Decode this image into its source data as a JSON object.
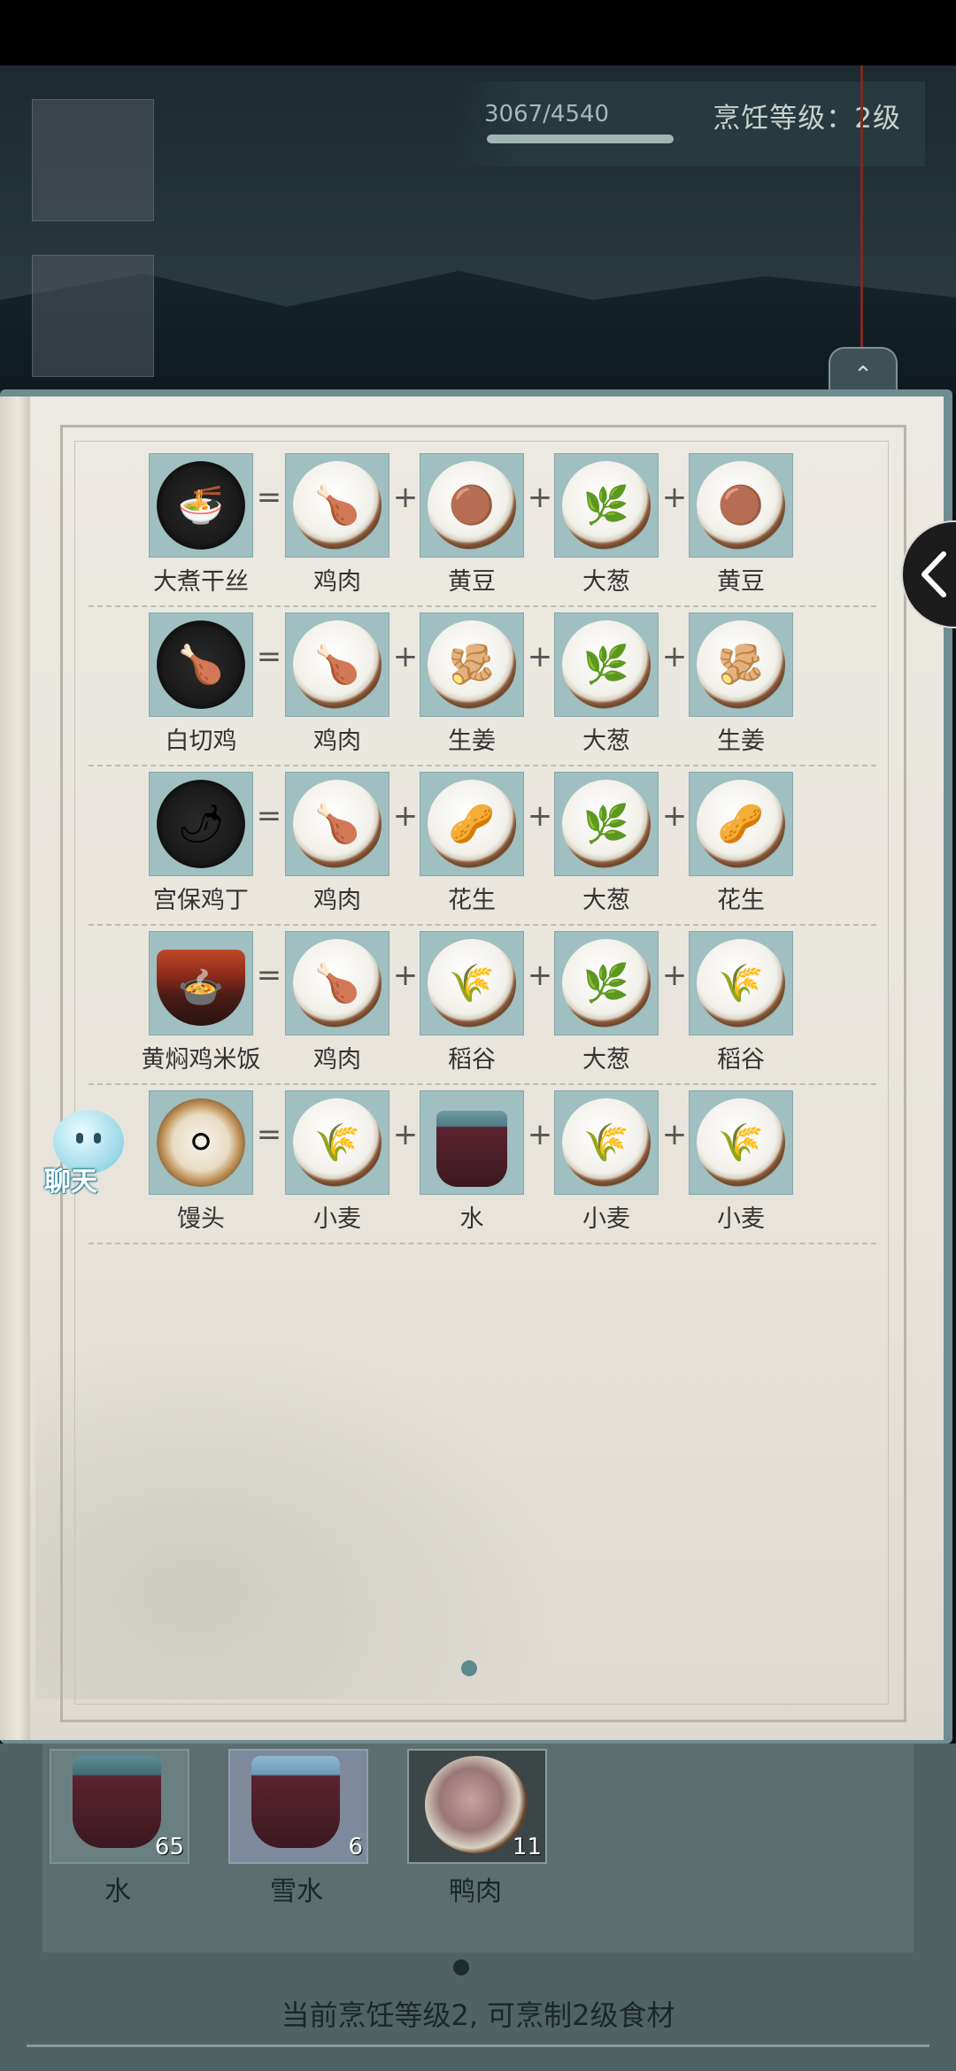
{
  "xp": {
    "text": "3067/4540",
    "current": 3067,
    "max": 4540
  },
  "cooking_level_text": "烹饪等级：2级",
  "recipes": [
    {
      "dish": "大煮干丝",
      "dish_icon": "shredded-tofu-dish-icon",
      "ops": [
        "=",
        "+",
        "+",
        "+"
      ],
      "ingredients": [
        {
          "name": "鸡肉",
          "icon": "chicken-meat-icon"
        },
        {
          "name": "黄豆",
          "icon": "soybean-icon"
        },
        {
          "name": "大葱",
          "icon": "scallion-icon"
        },
        {
          "name": "黄豆",
          "icon": "soybean-icon"
        }
      ]
    },
    {
      "dish": "白切鸡",
      "dish_icon": "white-cut-chicken-icon",
      "ops": [
        "=",
        "+",
        "+",
        "+"
      ],
      "ingredients": [
        {
          "name": "鸡肉",
          "icon": "chicken-meat-icon"
        },
        {
          "name": "生姜",
          "icon": "ginger-icon"
        },
        {
          "name": "大葱",
          "icon": "scallion-icon"
        },
        {
          "name": "生姜",
          "icon": "ginger-icon"
        }
      ]
    },
    {
      "dish": "宫保鸡丁",
      "dish_icon": "kung-pao-chicken-icon",
      "ops": [
        "=",
        "+",
        "+",
        "+"
      ],
      "ingredients": [
        {
          "name": "鸡肉",
          "icon": "chicken-meat-icon"
        },
        {
          "name": "花生",
          "icon": "peanut-icon"
        },
        {
          "name": "大葱",
          "icon": "scallion-icon"
        },
        {
          "name": "花生",
          "icon": "peanut-icon"
        }
      ]
    },
    {
      "dish": "黄焖鸡米饭",
      "dish_icon": "braised-chicken-rice-icon",
      "ops": [
        "=",
        "+",
        "+",
        "+"
      ],
      "ingredients": [
        {
          "name": "鸡肉",
          "icon": "chicken-meat-icon"
        },
        {
          "name": "稻谷",
          "icon": "rice-grain-icon"
        },
        {
          "name": "大葱",
          "icon": "scallion-icon"
        },
        {
          "name": "稻谷",
          "icon": "rice-grain-icon"
        }
      ]
    },
    {
      "dish": "馒头",
      "dish_icon": "steamed-bun-icon",
      "ops": [
        "=",
        "+",
        "+",
        "+"
      ],
      "ingredients": [
        {
          "name": "小麦",
          "icon": "wheat-icon"
        },
        {
          "name": "水",
          "icon": "water-bucket-icon"
        },
        {
          "name": "小麦",
          "icon": "wheat-icon"
        },
        {
          "name": "小麦",
          "icon": "wheat-icon"
        }
      ]
    }
  ],
  "chat_label": "聊天",
  "inventory": [
    {
      "name": "水",
      "count": "65",
      "icon": "water-bucket-icon"
    },
    {
      "name": "雪水",
      "count": "6",
      "icon": "snow-water-bucket-icon"
    },
    {
      "name": "鸭肉",
      "count": "11",
      "icon": "duck-meat-icon"
    }
  ],
  "status_text": "当前烹饪等级2, 可烹制2级食材",
  "colors": {
    "tile_bg": "#9fbfc0",
    "page_bg": "#ece9e2",
    "frame": "#6e8d90",
    "xp_fill": "#9fb7b3"
  }
}
